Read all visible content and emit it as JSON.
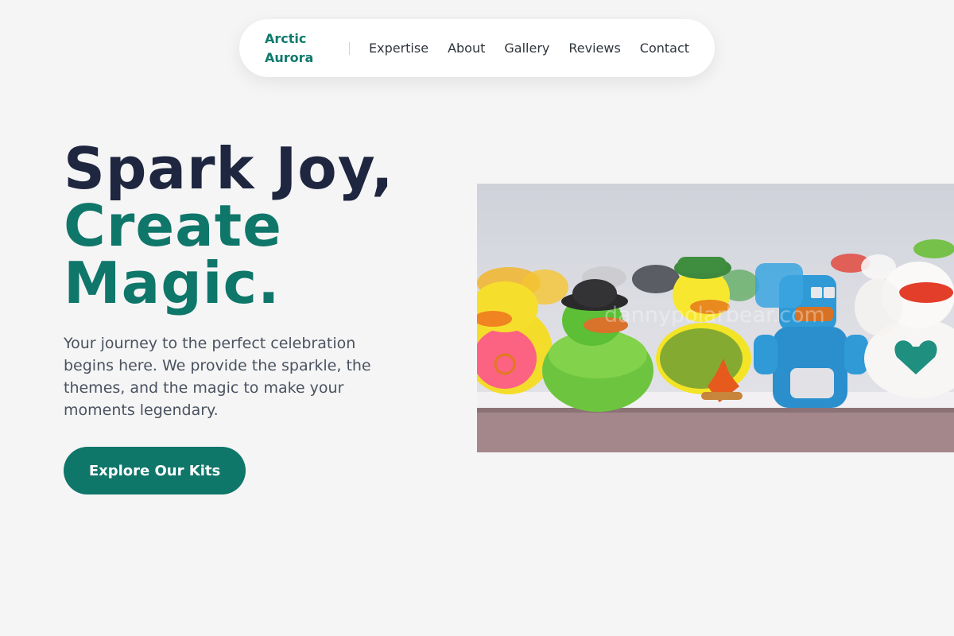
{
  "nav": {
    "brand": "Arctic Aurora",
    "links": [
      "Expertise",
      "About",
      "Gallery",
      "Reviews",
      "Contact"
    ]
  },
  "hero": {
    "title_line1": "Spark Joy,",
    "title_line2": "Create",
    "title_line3": "Magic.",
    "description": "Your journey to the perfect celebration begins here. We provide the sparkle, the themes, and the magic to make your moments legendary.",
    "cta_label": "Explore Our Kits",
    "image_watermark": "dannypolarbear.com"
  },
  "colors": {
    "accent": "#0f766a",
    "title_dark": "#1e2640",
    "background": "#f5f5f5"
  },
  "icons": {
    "hero_image": "rubber-ducks-photo"
  }
}
